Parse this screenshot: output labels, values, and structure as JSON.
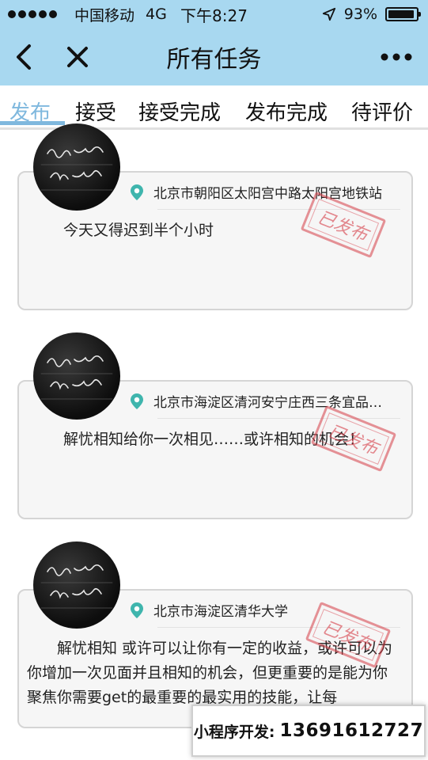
{
  "status": {
    "carrier": "中国移动",
    "network": "4G",
    "time": "下午8:27",
    "battery": "93%",
    "battery_level": 0.93
  },
  "nav": {
    "back_icon": "chevron-left-icon",
    "close_icon": "close-icon",
    "title": "所有任务",
    "more_icon": "more-icon"
  },
  "tabs": [
    {
      "label": "发布",
      "active": true
    },
    {
      "label": "接受",
      "active": false
    },
    {
      "label": "接受完成",
      "active": false
    },
    {
      "label": "发布完成",
      "active": false
    },
    {
      "label": "待评价",
      "active": false
    }
  ],
  "tasks": [
    {
      "location": "北京市朝阳区太阳宫中路太阳宫地铁站",
      "content": "今天又得迟到半个小时",
      "stamp": "已发布"
    },
    {
      "location": "北京市海淀区清河安宁庄西三条宜品…",
      "content": "解忧相知给你一次相见……或许相知的机会！",
      "stamp": "已发布"
    },
    {
      "location": "北京市海淀区清华大学",
      "content": "解忧相知 或许可以让你有一定的收益，或许可以为你增加一次见面并且相知的机会，但更重要的是能为你聚焦你需要get的最重要的最实用的技能，让每",
      "stamp": "已发布"
    }
  ],
  "promo": {
    "label": "小程序开发:",
    "phone": "13691612727"
  },
  "colors": {
    "header_bg": "#a8d8f0",
    "tab_active": "#7fb8de",
    "stamp_red": "#d63c46",
    "pin_teal": "#3fb5ad"
  }
}
